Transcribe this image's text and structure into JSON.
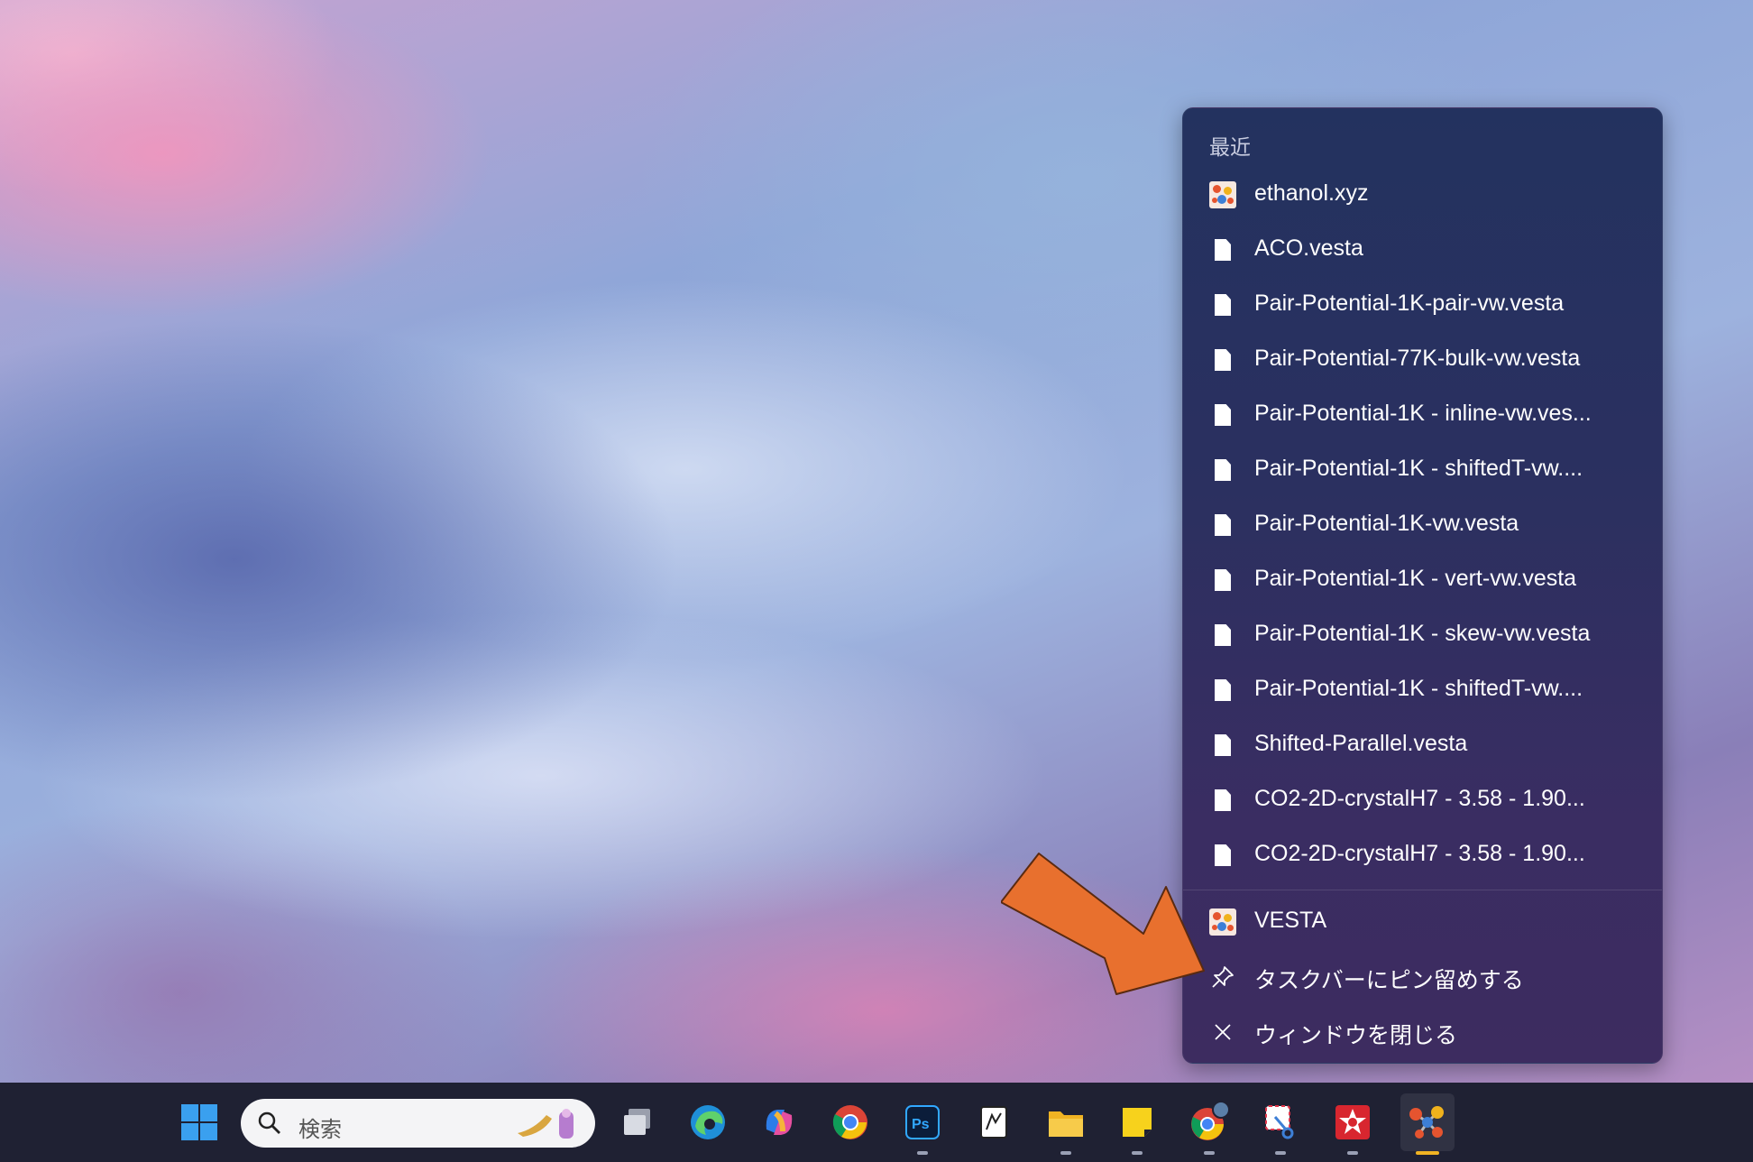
{
  "jump_list": {
    "heading": "最近",
    "recent_items": [
      {
        "label": "ethanol.xyz",
        "icon": "vesta-app-icon"
      },
      {
        "label": "ACO.vesta",
        "icon": "file-icon"
      },
      {
        "label": "Pair-Potential-1K-pair-vw.vesta",
        "icon": "file-icon"
      },
      {
        "label": "Pair-Potential-77K-bulk-vw.vesta",
        "icon": "file-icon"
      },
      {
        "label": "Pair-Potential-1K - inline-vw.ves...",
        "icon": "file-icon"
      },
      {
        "label": "Pair-Potential-1K - shiftedT-vw....",
        "icon": "file-icon"
      },
      {
        "label": "Pair-Potential-1K-vw.vesta",
        "icon": "file-icon"
      },
      {
        "label": "Pair-Potential-1K - vert-vw.vesta",
        "icon": "file-icon"
      },
      {
        "label": "Pair-Potential-1K - skew-vw.vesta",
        "icon": "file-icon"
      },
      {
        "label": "Pair-Potential-1K - shiftedT-vw....",
        "icon": "file-icon"
      },
      {
        "label": "Shifted-Parallel.vesta",
        "icon": "file-icon"
      },
      {
        "label": "CO2-2D-crystalH7 - 3.58 - 1.90...",
        "icon": "file-icon"
      },
      {
        "label": "CO2-2D-crystalH7 - 3.58 - 1.90...",
        "icon": "file-icon"
      }
    ],
    "app_name": "VESTA",
    "pin_label": "タスクバーにピン留めする",
    "close_label": "ウィンドウを閉じる"
  },
  "taskbar": {
    "search_placeholder": "検索",
    "apps": [
      "start",
      "task-view",
      "edge",
      "copilot",
      "chrome",
      "photoshop",
      "notepad-viewer",
      "file-explorer",
      "sticky-notes",
      "chrome-profile",
      "snipping-tool",
      "app-red",
      "vesta"
    ]
  },
  "colors": {
    "arrow": "#e8702e",
    "menu_bg": "#2b3060",
    "taskbar_bg": "#1f2133"
  }
}
